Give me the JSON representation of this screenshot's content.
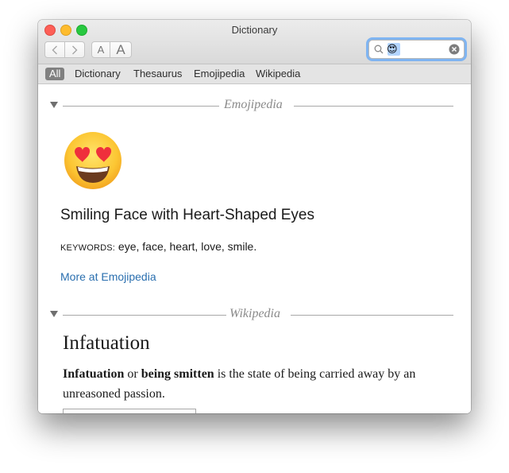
{
  "window": {
    "title": "Dictionary"
  },
  "toolbar": {
    "back_icon": "chevron-left-icon",
    "forward_icon": "chevron-right-icon",
    "font_smaller_label": "A",
    "font_larger_label": "A"
  },
  "search": {
    "value": "😍",
    "icon": "search-icon",
    "clear_icon": "clear-icon"
  },
  "scope": {
    "items": [
      "All",
      "Dictionary",
      "Thesaurus",
      "Emojipedia",
      "Wikipedia"
    ],
    "selected": "All"
  },
  "emojipedia": {
    "section_title": "Emojipedia",
    "emoji": "😍",
    "name": "Smiling Face with Heart-Shaped Eyes",
    "keywords_label": "KEYWORDS:",
    "keywords": "eye, face, heart, love, smile.",
    "more_link": "More at Emojipedia"
  },
  "wikipedia": {
    "section_title": "Wikipedia",
    "title": "Infatuation",
    "term1": "Infatuation",
    "or": " or ",
    "term2": "being smitten",
    "definition": " is the state of being carried away by an unreasoned passion."
  },
  "colors": {
    "link": "#2a6faf",
    "scope_selected_bg": "#808080",
    "search_focus": "#7fb4f1"
  }
}
